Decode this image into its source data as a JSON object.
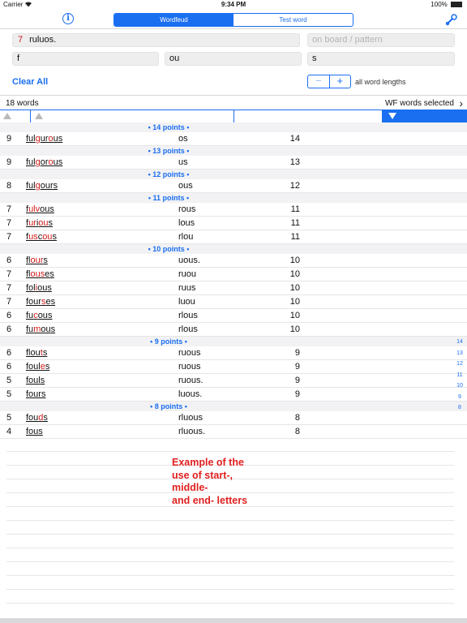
{
  "status_bar": {
    "carrier": "Carrier",
    "wifi": "wifi-icon",
    "time": "9:34 PM",
    "battery": "100%"
  },
  "nav": {
    "info_icon": "info-icon",
    "segments": [
      {
        "label": "Wordfeud",
        "active": true
      },
      {
        "label": "Test word",
        "active": false
      }
    ],
    "wrench_icon": "wrench-icon"
  },
  "letters_field": {
    "count": "7",
    "value": "ruluos."
  },
  "pattern_field": {
    "placeholder": "on board / pattern"
  },
  "start_field": {
    "value": "f"
  },
  "middle_field": {
    "value": "ou"
  },
  "end_field": {
    "value": "s"
  },
  "controls": {
    "clear_all": "Clear All",
    "minus": "−",
    "plus": "+",
    "lengths": "all word lengths"
  },
  "summary": {
    "count": "18 words",
    "wf_selected": "WF words selected",
    "chevron": "›"
  },
  "accent": "#1a6ef0",
  "highlight": "#d01a1a",
  "groups": [
    {
      "header": "• 14 points •",
      "words": [
        {
          "len": "9",
          "parts": [
            "ful",
            "g",
            "ur",
            "o",
            "us"
          ],
          "letters": "os",
          "points": "14"
        }
      ]
    },
    {
      "header": "• 13 points •",
      "words": [
        {
          "len": "9",
          "parts": [
            "ful",
            "g",
            "or",
            "o",
            "us"
          ],
          "letters": "us",
          "points": "13"
        }
      ]
    },
    {
      "header": "• 12 points •",
      "words": [
        {
          "len": "8",
          "parts": [
            "ful",
            "g",
            "our",
            "",
            "s"
          ],
          "letters": "ous",
          "points": "12"
        }
      ]
    },
    {
      "header": "• 11 points •",
      "words": [
        {
          "len": "7",
          "parts": [
            "f",
            "ulv",
            "ou",
            "",
            "s"
          ],
          "letters": "rous",
          "points": "11"
        },
        {
          "len": "7",
          "parts": [
            "f",
            "ur",
            "i",
            "ou",
            "s"
          ],
          "letters": "lous",
          "points": "11"
        },
        {
          "len": "7",
          "parts": [
            "f",
            "us",
            "c",
            "ou",
            "s"
          ],
          "letters": "rlou",
          "points": "11"
        }
      ]
    },
    {
      "header": "• 10 points •",
      "words": [
        {
          "len": "6",
          "parts": [
            "fl",
            "our",
            "s",
            "",
            ""
          ],
          "letters": "uous.",
          "points": "10"
        },
        {
          "len": "7",
          "parts": [
            "fl",
            "ous",
            "e",
            "",
            "s"
          ],
          "letters": "ruou",
          "points": "10"
        },
        {
          "len": "7",
          "parts": [
            "fol",
            "i",
            "ou",
            "",
            "s"
          ],
          "letters": "ruus",
          "points": "10"
        },
        {
          "len": "7",
          "parts": [
            "four",
            "s",
            "e",
            "",
            "s"
          ],
          "letters": "luou",
          "points": "10"
        },
        {
          "len": "6",
          "parts": [
            "fu",
            "c",
            "ou",
            "",
            "s"
          ],
          "letters": "rlous",
          "points": "10"
        },
        {
          "len": "6",
          "parts": [
            "fu",
            "m",
            "ou",
            "",
            "s"
          ],
          "letters": "rlous",
          "points": "10"
        }
      ]
    },
    {
      "header": "• 9 points •",
      "words": [
        {
          "len": "6",
          "parts": [
            "flou",
            "t",
            "s",
            "",
            ""
          ],
          "letters": "ruous",
          "points": "9"
        },
        {
          "len": "6",
          "parts": [
            "foul",
            "e",
            "s",
            "",
            ""
          ],
          "letters": "ruous",
          "points": "9"
        },
        {
          "len": "5",
          "parts": [
            "foul",
            "",
            "s",
            "",
            ""
          ],
          "letters": "ruous.",
          "points": "9"
        },
        {
          "len": "5",
          "parts": [
            "four",
            "",
            "s",
            "",
            ""
          ],
          "letters": "luous.",
          "points": "9"
        }
      ]
    },
    {
      "header": "• 8 points •",
      "words": [
        {
          "len": "5",
          "parts": [
            "fou",
            "d",
            "s",
            "",
            ""
          ],
          "letters": "rluous",
          "points": "8"
        },
        {
          "len": "4",
          "parts": [
            "fous",
            "",
            "",
            "",
            ""
          ],
          "letters": "rluous.",
          "points": "8"
        }
      ]
    }
  ],
  "annotation": [
    "Example of the",
    "use of start-,",
    "middle-",
    "and end- letters"
  ],
  "index": [
    "14",
    "13",
    "12",
    "11",
    "10",
    "9",
    "8"
  ]
}
